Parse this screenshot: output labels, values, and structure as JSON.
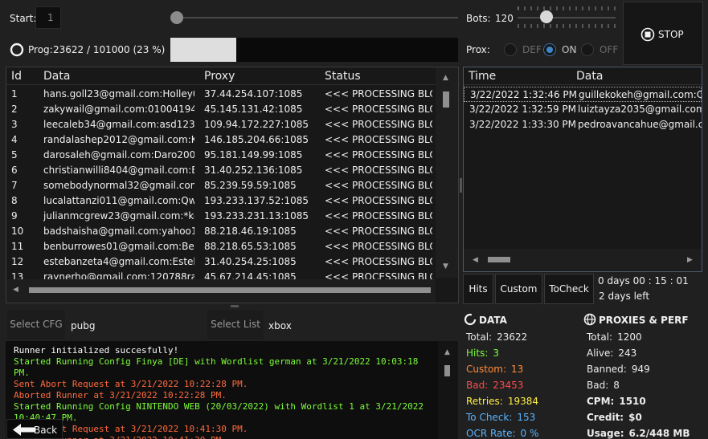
{
  "top": {
    "start_label": "Start:",
    "start_value": "1",
    "bots_label": "Bots:",
    "bots_value": "120",
    "stop_label": "STOP",
    "prog_label": "Prog:",
    "prog_value": "23622  /  101000  (23 %)",
    "progress_fraction": 0.23,
    "prox_label": "Prox:",
    "prox_options": [
      "DEF",
      "ON",
      "OFF"
    ],
    "prox_selected": "ON"
  },
  "data_grid": {
    "headers": [
      "Id",
      "Data",
      "Proxy",
      "Status"
    ],
    "rows": [
      [
        "1",
        "hans.goll23@gmail.com:Holley0522",
        "37.44.254.107:1085",
        "<<< PROCESSING BLOCK"
      ],
      [
        "2",
        "zakywail@gmail.com:01004194616z",
        "45.145.131.42:1085",
        "<<< PROCESSING BLOCK"
      ],
      [
        "3",
        "leecaleb34@gmail.com:asd123",
        "109.94.172.227:1085",
        "<<< PROCESSING BLOCK"
      ],
      [
        "4",
        "randalashep2012@gmail.com:Kylun",
        "146.185.204.66:1085",
        "<<< PROCESSING BLOCK"
      ],
      [
        "5",
        "darosaleh@gmail.com:Daro2001",
        "95.181.149.99:1085",
        "<<< PROCESSING BLOCK"
      ],
      [
        "6",
        "christianwilli8404@gmail.com:Baller",
        "31.40.252.136:1085",
        "<<< PROCESSING BLOCK"
      ],
      [
        "7",
        "somebodynormal32@gmail.com:mi",
        "85.239.59.59:1085",
        "<<< PROCESSING BLOCK"
      ],
      [
        "8",
        "lucalattanzi011@gmail.com:Qwerty",
        "193.233.137.52:1085",
        "<<< PROCESSING BLOCK"
      ],
      [
        "9",
        "julianmcgrew23@gmail.com:*kenzo",
        "193.233.231.13:1085",
        "<<< PROCESSING BLOCK"
      ],
      [
        "10",
        "badshaisha@gmail.com:yahoo1234",
        "88.218.46.19:1085",
        "<<< PROCESSING BLOCK"
      ],
      [
        "11",
        "benburrowes01@gmail.com:Benbur",
        "88.218.65.53:1085",
        "<<< PROCESSING BLOCK"
      ],
      [
        "12",
        "estebanzeta4@gmail.com:Esteban1",
        "31.40.254.25:1085",
        "<<< PROCESSING BLOCK"
      ],
      [
        "13",
        "raynerho@gmail.com:120788ray",
        "45.67.214.45:1085",
        "<<< PROCESSING BLOCK"
      ]
    ]
  },
  "hits_grid": {
    "headers": [
      "Time",
      "Data"
    ],
    "rows": [
      [
        "3/22/2022 1:32:46 PM",
        "guillekokeh@gmail.com:Canc"
      ],
      [
        "3/22/2022 1:32:59 PM",
        "luiztayza2035@gmail.com:luiz"
      ],
      [
        "3/22/2022 1:33:30 PM",
        "pedroavancahue@gmail.com"
      ]
    ]
  },
  "tabs": [
    "Hits",
    "Custom",
    "ToCheck"
  ],
  "timer": {
    "elapsed": "0  days  00 : 15 : 01",
    "left": "2 days left"
  },
  "cfg": {
    "button": "Select CFG",
    "value": "pubg",
    "list_button": "Select List",
    "list_value": "xbox"
  },
  "log": [
    {
      "text": "Runner initialized succesfully!",
      "color": "#ffffff"
    },
    {
      "text": "Started Running Config Finya [DE] with Wordlist german at 3/21/2022 10:03:18",
      "color": "#7cfc3a"
    },
    {
      "text": "PM.",
      "color": "#7cfc3a"
    },
    {
      "text": "Sent Abort Request at 3/21/2022 10:22:28 PM.",
      "color": "#ff6a3d"
    },
    {
      "text": "Aborted Runner at 3/21/2022 10:22:28 PM.",
      "color": "#ff6a3d"
    },
    {
      "text": "Started Running Config NINTENDO WEB (20/03/2022) with Wordlist 1 at 3/21/2022",
      "color": "#7cfc3a"
    },
    {
      "text": "10:40:47 PM.",
      "color": "#7cfc3a"
    },
    {
      "text": "Sent Abort Request at 3/21/2022 10:41:30 PM.",
      "color": "#ff6a3d"
    },
    {
      "text": "Aborted Runner at 3/21/2022 10:41:30 PM.",
      "color": "#ff6a3d"
    }
  ],
  "back_label": "Back",
  "data_stats": {
    "title": "DATA",
    "items": [
      {
        "label": "Total:",
        "value": "23622",
        "color": "#e6e6e6"
      },
      {
        "label": "Hits:",
        "value": "3",
        "color": "#7cfc3a"
      },
      {
        "label": "Custom:",
        "value": "13",
        "color": "#ff8c3a"
      },
      {
        "label": "Bad:",
        "value": "23453",
        "color": "#ff4a4a"
      },
      {
        "label": "Retries:",
        "value": "19384",
        "color": "#ffee44"
      },
      {
        "label": "To Check:",
        "value": "153",
        "color": "#5ab4ff"
      },
      {
        "label": "OCR Rate:",
        "value": "0 %",
        "color": "#5ab4ff"
      }
    ]
  },
  "perf_stats": {
    "title": "PROXIES & PERF",
    "items": [
      {
        "label": "Total:",
        "value": "1200"
      },
      {
        "label": "Alive:",
        "value": "243"
      },
      {
        "label": "Banned:",
        "value": "949"
      },
      {
        "label": "Bad:",
        "value": "8"
      },
      {
        "label": "CPM:",
        "value": "1510"
      },
      {
        "label": "Credit:",
        "value": "$0"
      },
      {
        "label": "Usage:",
        "value": "6.2/448 MB"
      }
    ]
  }
}
